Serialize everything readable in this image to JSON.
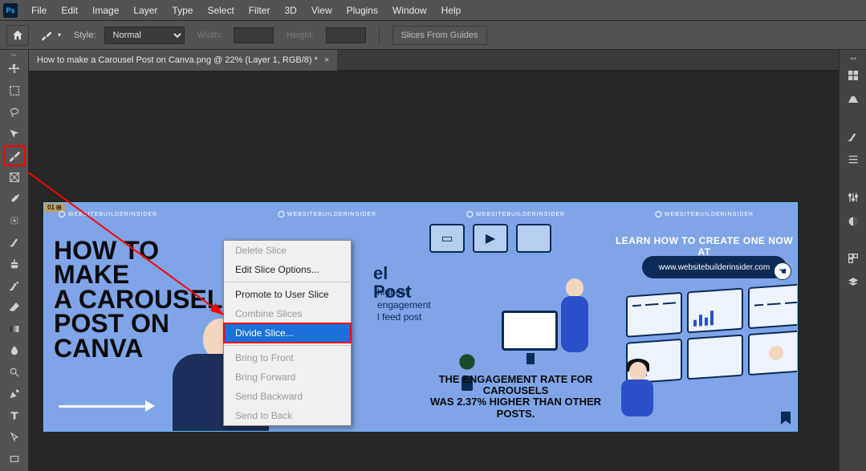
{
  "app": {
    "icon_label": "Ps"
  },
  "menubar": [
    "File",
    "Edit",
    "Image",
    "Layer",
    "Type",
    "Select",
    "Filter",
    "3D",
    "View",
    "Plugins",
    "Window",
    "Help"
  ],
  "optionsbar": {
    "style_label": "Style:",
    "style_value": "Normal",
    "width_label": "Width:",
    "width_value": "",
    "height_label": "Height:",
    "height_value": "",
    "slices_btn": "Slices From Guides"
  },
  "document": {
    "tab_title": "How to make a Carousel Post on Canva.png @ 22% (Layer 1, RGB/8) *"
  },
  "slice": {
    "badge": "01"
  },
  "artboard": {
    "brand": "WEBSITEBUILDERINSIDER",
    "panel1_title": "HOW TO MAKE\nA CAROUSEL\nPOST ON\nCANVA",
    "panel2_title": "el Post",
    "panel2_sub": "highest\nengagement\nl feed post",
    "panel3_caption_line1": "THE ENGAGEMENT RATE FOR CAROUSELS",
    "panel3_caption_line2": "WAS 2.37% HIGHER THAN OTHER POSTS.",
    "panel4_headline": "LEARN HOW TO CREATE ONE NOW AT",
    "panel4_url": "www.websitebuilderinsider.com"
  },
  "context_menu": {
    "items": [
      {
        "label": "Delete Slice",
        "disabled": true
      },
      {
        "label": "Edit Slice Options...",
        "disabled": false
      },
      {
        "sep": true
      },
      {
        "label": "Promote to User Slice",
        "disabled": false
      },
      {
        "label": "Combine Slices",
        "disabled": true
      },
      {
        "label": "Divide Slice...",
        "highlight": true
      },
      {
        "sep": true
      },
      {
        "label": "Bring to Front",
        "disabled": true
      },
      {
        "label": "Bring Forward",
        "disabled": true
      },
      {
        "label": "Send Backward",
        "disabled": true
      },
      {
        "label": "Send to Back",
        "disabled": true
      }
    ]
  }
}
